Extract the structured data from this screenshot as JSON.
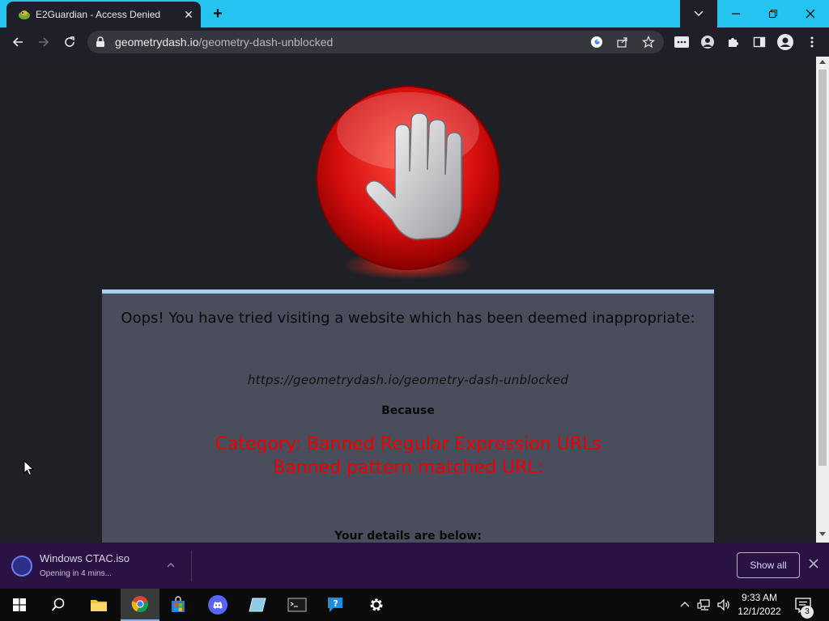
{
  "browser": {
    "tab_title": "E2Guardian - Access Denied",
    "tab_close": "✕",
    "new_tab": "+",
    "url_host": "geometrydash.io",
    "url_path": "/geometry-dash-unblocked"
  },
  "page": {
    "heading": "Oops! You have tried visiting a website which has been deemed inappropriate:",
    "blocked_url": "https://geometrydash.io/geometry-dash-unblocked",
    "because": "Because",
    "category": "Category: Banned Regular Expression URLs",
    "pattern": "Banned pattern matched URL:",
    "details": "Your details are below:"
  },
  "download_shelf": {
    "file_name": "Windows CTAC.iso",
    "status": "Opening in 4 mins...",
    "show_all": "Show all"
  },
  "taskbar": {
    "time": "9:33 AM",
    "date": "12/1/2022",
    "notification_count": "3"
  },
  "colors": {
    "titlebar": "#25c4f0",
    "toolbar": "#1f1f29",
    "panel": "#4a4d5c",
    "panel_accent": "#a8d0f0",
    "reason_text": "#ee0000",
    "shelf": "#2b1244"
  }
}
